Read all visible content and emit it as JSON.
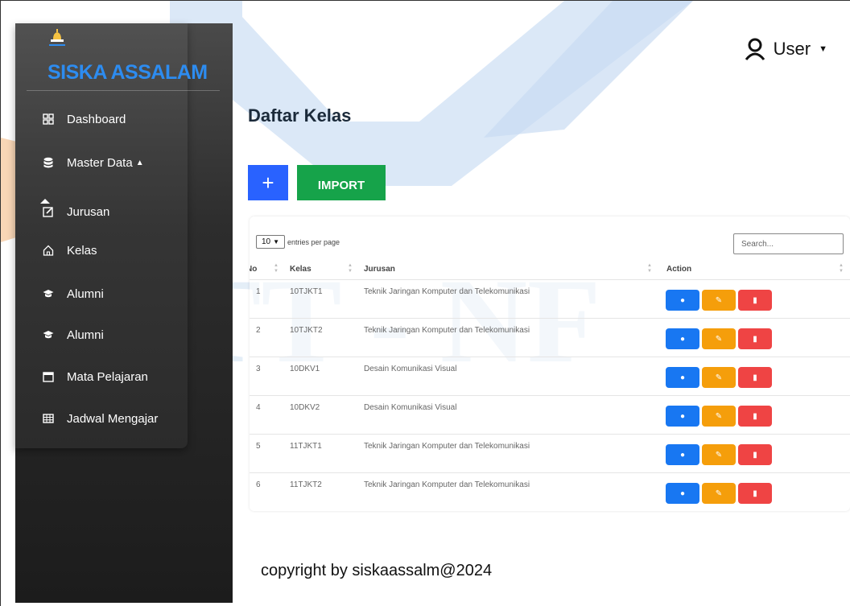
{
  "brand": {
    "name": "SISKA ASSALAM"
  },
  "sidebar": {
    "items": [
      {
        "label": "Dashboard",
        "icon": "dashboard-grid-icon"
      },
      {
        "label": "Master Data",
        "icon": "database-icon"
      },
      {
        "label": "Jurusan",
        "icon": "edit-square-icon"
      },
      {
        "label": "Kelas",
        "icon": "home-icon"
      },
      {
        "label": "Alumni",
        "icon": "graduation-cap-icon"
      },
      {
        "label": "Alumni",
        "icon": "graduation-cap-icon"
      },
      {
        "label": "Mata Pelajaran",
        "icon": "calendar-icon"
      },
      {
        "label": "Jadwal Mengajar",
        "icon": "table-icon"
      }
    ]
  },
  "header": {
    "user_label": "User"
  },
  "main": {
    "title": "Daftar Kelas",
    "add_label": "+",
    "import_label": "IMPORT"
  },
  "table": {
    "page_size": "10",
    "entries_label": "entries per page",
    "search_placeholder": "Search...",
    "columns": [
      "No",
      "Kelas",
      "Jurusan",
      "Action"
    ],
    "rows": [
      {
        "no": "1",
        "kelas": "10TJKT1",
        "jurusan": "Teknik Jaringan Komputer dan Telekomunikasi"
      },
      {
        "no": "2",
        "kelas": "10TJKT2",
        "jurusan": "Teknik Jaringan Komputer dan Telekomunikasi"
      },
      {
        "no": "3",
        "kelas": "10DKV1",
        "jurusan": "Desain Komunikasi Visual"
      },
      {
        "no": "4",
        "kelas": "10DKV2",
        "jurusan": "Desain Komunikasi Visual"
      },
      {
        "no": "5",
        "kelas": "11TJKT1",
        "jurusan": "Teknik Jaringan Komputer dan Telekomunikasi"
      },
      {
        "no": "6",
        "kelas": "11TJKT2",
        "jurusan": "Teknik Jaringan Komputer dan Telekomunikasi"
      }
    ]
  },
  "footer": {
    "text": "copyright by siskaassalm@2024"
  },
  "watermark": {
    "text": "STT - NF"
  },
  "colors": {
    "add_button": "#2962ff",
    "import_button": "#16a34a",
    "view_button": "#1877f2",
    "edit_button": "#f59e0b",
    "delete_button": "#ef4444",
    "brand": "#2d8cf0"
  }
}
